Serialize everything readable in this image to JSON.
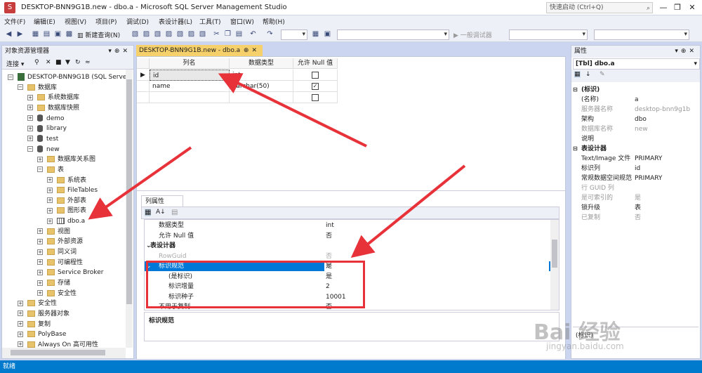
{
  "window": {
    "title": "DESKTOP-BNN9G1B.new - dbo.a - Microsoft SQL Server Management Studio",
    "quick_launch_placeholder": "快速启动 (Ctrl+Q)",
    "minimize": "—",
    "restore": "❐",
    "close": "✕"
  },
  "menu": [
    "文件(F)",
    "编辑(E)",
    "视图(V)",
    "项目(P)",
    "调试(D)",
    "表设计器(L)",
    "工具(T)",
    "窗口(W)",
    "帮助(H)"
  ],
  "toolbar": {
    "new_query": "新建查询(N)",
    "debugger_label": "一般调试器"
  },
  "object_explorer": {
    "title": "对象资源管理器",
    "connect": "连接",
    "tree": [
      {
        "label": "DESKTOP-BNN9G1B (SQL Server",
        "level": 0,
        "icon": "server",
        "exp": "−"
      },
      {
        "label": "数据库",
        "level": 1,
        "icon": "folder",
        "exp": "−"
      },
      {
        "label": "系统数据库",
        "level": 2,
        "icon": "folder",
        "exp": "+"
      },
      {
        "label": "数据库快照",
        "level": 2,
        "icon": "folder",
        "exp": "+"
      },
      {
        "label": "demo",
        "level": 2,
        "icon": "db",
        "exp": "+"
      },
      {
        "label": "library",
        "level": 2,
        "icon": "db",
        "exp": "+"
      },
      {
        "label": "test",
        "level": 2,
        "icon": "db",
        "exp": "+"
      },
      {
        "label": "new",
        "level": 2,
        "icon": "db",
        "exp": "−"
      },
      {
        "label": "数据库关系图",
        "level": 3,
        "icon": "folder",
        "exp": "+"
      },
      {
        "label": "表",
        "level": 3,
        "icon": "folder",
        "exp": "−"
      },
      {
        "label": "系统表",
        "level": 4,
        "icon": "folder",
        "exp": "+"
      },
      {
        "label": "FileTables",
        "level": 4,
        "icon": "folder",
        "exp": "+"
      },
      {
        "label": "外部表",
        "level": 4,
        "icon": "folder",
        "exp": "+"
      },
      {
        "label": "图形表",
        "level": 4,
        "icon": "folder",
        "exp": "+"
      },
      {
        "label": "dbo.a",
        "level": 4,
        "icon": "table",
        "exp": "+"
      },
      {
        "label": "视图",
        "level": 3,
        "icon": "folder",
        "exp": "+"
      },
      {
        "label": "外部资源",
        "level": 3,
        "icon": "folder",
        "exp": "+"
      },
      {
        "label": "同义词",
        "level": 3,
        "icon": "folder",
        "exp": "+"
      },
      {
        "label": "可编程性",
        "level": 3,
        "icon": "folder",
        "exp": "+"
      },
      {
        "label": "Service Broker",
        "level": 3,
        "icon": "folder",
        "exp": "+"
      },
      {
        "label": "存储",
        "level": 3,
        "icon": "folder",
        "exp": "+"
      },
      {
        "label": "安全性",
        "level": 3,
        "icon": "folder",
        "exp": "+"
      },
      {
        "label": "安全性",
        "level": 1,
        "icon": "folder",
        "exp": "+"
      },
      {
        "label": "服务器对象",
        "level": 1,
        "icon": "folder",
        "exp": "+"
      },
      {
        "label": "复制",
        "level": 1,
        "icon": "folder",
        "exp": "+"
      },
      {
        "label": "PolyBase",
        "level": 1,
        "icon": "folder",
        "exp": "+"
      },
      {
        "label": "Always On 高可用性",
        "level": 1,
        "icon": "folder",
        "exp": "+"
      }
    ]
  },
  "doc_tab": {
    "label": "DESKTOP-BNN9G1B.new - dbo.a",
    "pin": "⊕",
    "close": "✕"
  },
  "table_grid": {
    "headers": [
      "列名",
      "数据类型",
      "允许 Null 值"
    ],
    "rows": [
      {
        "name": "id",
        "type": "int",
        "nullable": false,
        "selected": true
      },
      {
        "name": "name",
        "type": "varchar(50)",
        "nullable": true,
        "selected": false
      },
      {
        "name": "",
        "type": "",
        "nullable": false,
        "selected": false
      }
    ]
  },
  "column_properties": {
    "tab": "列属性",
    "rows": [
      {
        "name": "数据类型",
        "value": "int",
        "kind": "normal"
      },
      {
        "name": "允许 Null 值",
        "value": "否",
        "kind": "normal"
      },
      {
        "name": "表设计器",
        "value": "",
        "kind": "cat"
      },
      {
        "name": "RowGuid",
        "value": "否",
        "kind": "gray"
      },
      {
        "name": "标识规范",
        "value": "是",
        "kind": "sel"
      },
      {
        "name": "(是标识)",
        "value": "是",
        "kind": "sub"
      },
      {
        "name": "标识增量",
        "value": "2",
        "kind": "sub"
      },
      {
        "name": "标识种子",
        "value": "10001",
        "kind": "sub"
      },
      {
        "name": "不用于复制",
        "value": "否",
        "kind": "normal"
      }
    ],
    "description": "标识规范"
  },
  "properties": {
    "title": "属性",
    "object": "[Tbl] dbo.a",
    "rows": [
      {
        "name": "(标识)",
        "value": "",
        "kind": "cat"
      },
      {
        "name": "(名称)",
        "value": "a",
        "kind": "normal"
      },
      {
        "name": "服务器名称",
        "value": "desktop-bnn9g1b",
        "kind": "gray"
      },
      {
        "name": "架构",
        "value": "dbo",
        "kind": "normal"
      },
      {
        "name": "数据库名称",
        "value": "new",
        "kind": "gray"
      },
      {
        "name": "说明",
        "value": "",
        "kind": "normal"
      },
      {
        "name": "表设计器",
        "value": "",
        "kind": "cat"
      },
      {
        "name": "Text/Image 文件",
        "value": "PRIMARY",
        "kind": "normal"
      },
      {
        "name": "标识列",
        "value": "id",
        "kind": "normal"
      },
      {
        "name": "常规数据空间规范",
        "value": "PRIMARY",
        "kind": "normal"
      },
      {
        "name": "行 GUID 列",
        "value": "",
        "kind": "gray"
      },
      {
        "name": "是可索引的",
        "value": "是",
        "kind": "gray"
      },
      {
        "name": "锁升级",
        "value": "表",
        "kind": "normal"
      },
      {
        "name": "已复制",
        "value": "否",
        "kind": "gray"
      }
    ],
    "description": "(标识)"
  },
  "status": "就绪",
  "watermark": {
    "main": "Bai 经验",
    "sub": "jingyan.baidu.com"
  },
  "colors": {
    "accent": "#007acc",
    "selection": "#0078d7",
    "annotation": "#e8323a",
    "tab": "#f6d16b"
  }
}
